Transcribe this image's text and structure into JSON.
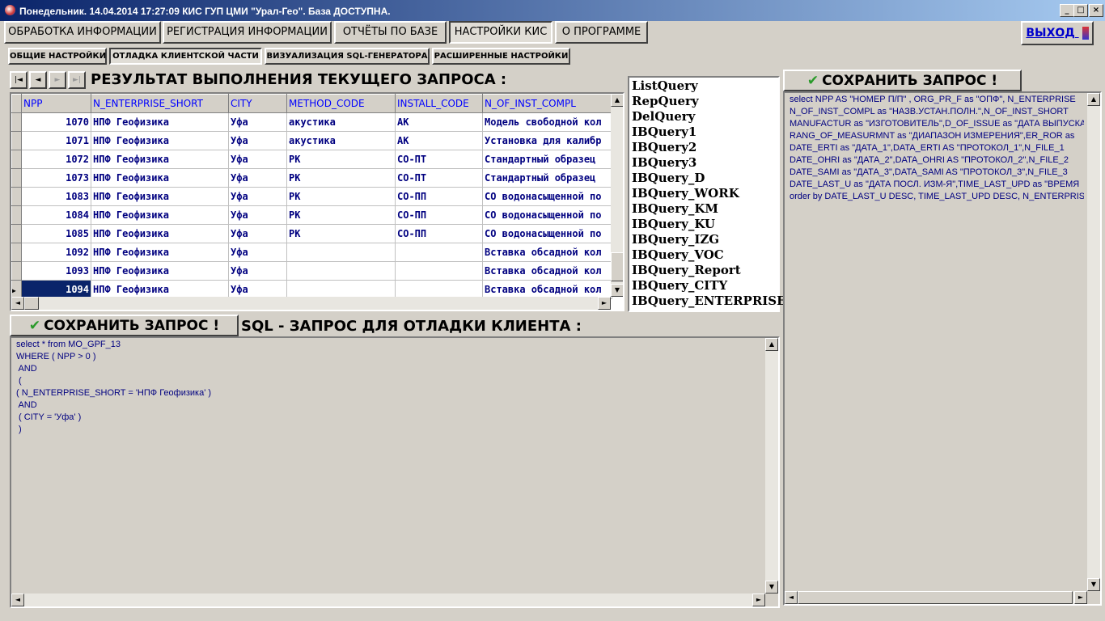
{
  "window": {
    "title": "Понедельник. 14.04.2014 17:27:09  КИС ГУП ЦМИ \"Урал-Гео\". База ДОСТУПНА.",
    "controls": [
      "_",
      "□",
      "×"
    ]
  },
  "main_tabs": [
    {
      "label": "ОБРАБОТКА ИНФОРМАЦИИ"
    },
    {
      "label": "РЕГИСТРАЦИЯ ИНФОРМАЦИИ"
    },
    {
      "label": "ОТЧЁТЫ ПО БАЗЕ"
    },
    {
      "label": "НАСТРОЙКИ КИС"
    },
    {
      "label": "О ПРОГРАММЕ"
    }
  ],
  "exit_label": "ВЫХОД",
  "sub_tabs": [
    {
      "label": "ОБЩИЕ НАСТРОЙКИ"
    },
    {
      "label": "ОТЛАДКА КЛИЕНТСКОЙ ЧАСТИ"
    },
    {
      "label": "ВИЗУАЛИЗАЦИЯ SQL-ГЕНЕРАТОРА"
    },
    {
      "label": "РАСШИРЕННЫЕ НАСТРОЙКИ"
    }
  ],
  "nav_buttons": [
    "|◄",
    "◄",
    "►",
    "►|"
  ],
  "result_heading": "РЕЗУЛЬТАТ ВЫПОЛНЕНИЯ ТЕКУЩЕГО ЗАПРОСА :",
  "grid": {
    "columns": [
      "NPP",
      "N_ENTERPRISE_SHORT",
      "CITY",
      "METHOD_CODE",
      "INSTALL_CODE",
      "N_OF_INST_COMPL"
    ],
    "rows": [
      {
        "npp": "1070",
        "ent": "НПФ Геофизика",
        "city": "Уфа",
        "method": "акустика",
        "install": "АК",
        "compl": "Модель свободной кол"
      },
      {
        "npp": "1071",
        "ent": "НПФ Геофизика",
        "city": "Уфа",
        "method": "акустика",
        "install": "АК",
        "compl": "Установка для калибр"
      },
      {
        "npp": "1072",
        "ent": "НПФ Геофизика",
        "city": "Уфа",
        "method": "РК",
        "install": "СО-ПТ",
        "compl": "Стандартный образец"
      },
      {
        "npp": "1073",
        "ent": "НПФ Геофизика",
        "city": "Уфа",
        "method": "РК",
        "install": "СО-ПТ",
        "compl": "Стандартный образец"
      },
      {
        "npp": "1083",
        "ent": "НПФ Геофизика",
        "city": "Уфа",
        "method": "РК",
        "install": "СО-ПП",
        "compl": "СО водонасыщенной по"
      },
      {
        "npp": "1084",
        "ent": "НПФ Геофизика",
        "city": "Уфа",
        "method": "РК",
        "install": "СО-ПП",
        "compl": "СО водонасыщенной по"
      },
      {
        "npp": "1085",
        "ent": "НПФ Геофизика",
        "city": "Уфа",
        "method": "РК",
        "install": "СО-ПП",
        "compl": "СО водонасыщенной по"
      },
      {
        "npp": "1092",
        "ent": "НПФ Геофизика",
        "city": "Уфа",
        "method": "",
        "install": "",
        "compl": "Вставка обсадной кол"
      },
      {
        "npp": "1093",
        "ent": "НПФ Геофизика",
        "city": "Уфа",
        "method": "",
        "install": "",
        "compl": "Вставка обсадной кол"
      },
      {
        "npp": "1094",
        "ent": "НПФ Геофизика",
        "city": "Уфа",
        "method": "",
        "install": "",
        "compl": "Вставка обсадной кол"
      }
    ]
  },
  "query_list": [
    "ListQuery",
    "RepQuery",
    "DelQuery",
    "IBQuery1",
    "IBQuery2",
    "IBQuery3",
    "IBQuery_D",
    "IBQuery_WORK",
    "IBQuery_KM",
    "IBQuery_KU",
    "IBQuery_IZG",
    "IBQuery_VOC",
    "IBQuery_Report",
    "IBQuery_CITY",
    "IBQuery_ENTERPRISE"
  ],
  "save_button_label": "СОХРАНИТЬ ЗАПРОС !",
  "save_button_right_label": "СОХРАНИТЬ ЗАПРОС !",
  "sql_heading": "SQL - ЗАПРОС ДЛЯ ОТЛАДКИ КЛИЕНТА :",
  "sql_lines": [
    "select * from MO_GPF_13",
    "WHERE ( NPP > 0 )",
    " AND",
    " (",
    "( N_ENTERPRISE_SHORT = 'НПФ Геофизика' )",
    " AND",
    " ( CITY = 'Уфа' )",
    " )"
  ],
  "right_sql_lines": [
    "select NPP AS \"НОМЕР П/П\" , ORG_PR_F as \"ОПФ\",  N_ENTERPRISE",
    "N_OF_INST_COMPL as \"НАЗВ.УСТАН.ПОЛН.\",N_OF_INST_SHORT",
    "MANUFACTUR as \"ИЗГОТОВИТЕЛЬ\",D_OF_ISSUE as \"ДАТА ВЫПУСКА",
    "RANG_OF_MEASURMNT as \"ДИАПАЗОН ИЗМЕРЕНИЯ\",ER_ROR as",
    "DATE_ERTI as \"ДАТА_1\",DATA_ERTI AS \"ПРОТОКОЛ_1\",N_FILE_1",
    "DATE_OHRI as \"ДАТА_2\",DATA_OHRI AS \"ПРОТОКОЛ_2\",N_FILE_2",
    "DATE_SAMI as \"ДАТА_3\",DATA_SAMI AS \"ПРОТОКОЛ_3\",N_FILE_3",
    "DATE_LAST_U as \"ДАТА ПОСЛ. ИЗМ-Я\",TIME_LAST_UPD as \"ВРЕМЯ",
    "order by DATE_LAST_U DESC, TIME_LAST_UPD DESC, N_ENTERPRISE"
  ]
}
